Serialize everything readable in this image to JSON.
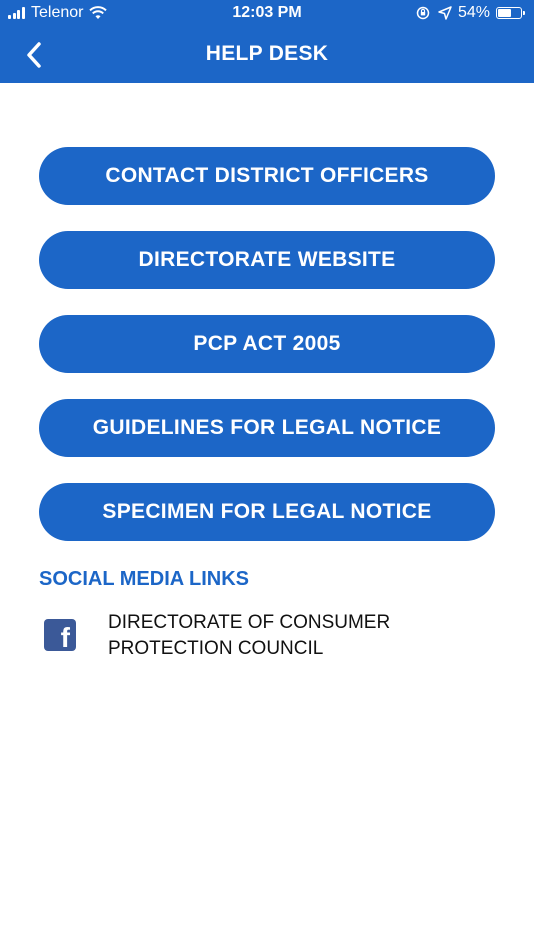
{
  "status_bar": {
    "carrier": "Telenor",
    "time": "12:03 PM",
    "battery": "54%",
    "battery_level": 0.54
  },
  "header": {
    "title": "HELP DESK",
    "back_icon": "chevron-left-icon"
  },
  "menu": {
    "buttons": [
      {
        "label": "CONTACT DISTRICT OFFICERS"
      },
      {
        "label": "DIRECTORATE WEBSITE"
      },
      {
        "label": "PCP ACT 2005"
      },
      {
        "label": "GUIDELINES FOR LEGAL NOTICE"
      },
      {
        "label": "SPECIMEN FOR LEGAL NOTICE"
      }
    ]
  },
  "social": {
    "title": "SOCIAL MEDIA LINKS",
    "links": [
      {
        "icon": "facebook-icon",
        "label_line1": "DIRECTORATE OF CONSUMER",
        "label_line2": "PROTECTION COUNCIL"
      }
    ]
  },
  "colors": {
    "primary": "#1c66c7",
    "facebook": "#3b5998"
  }
}
